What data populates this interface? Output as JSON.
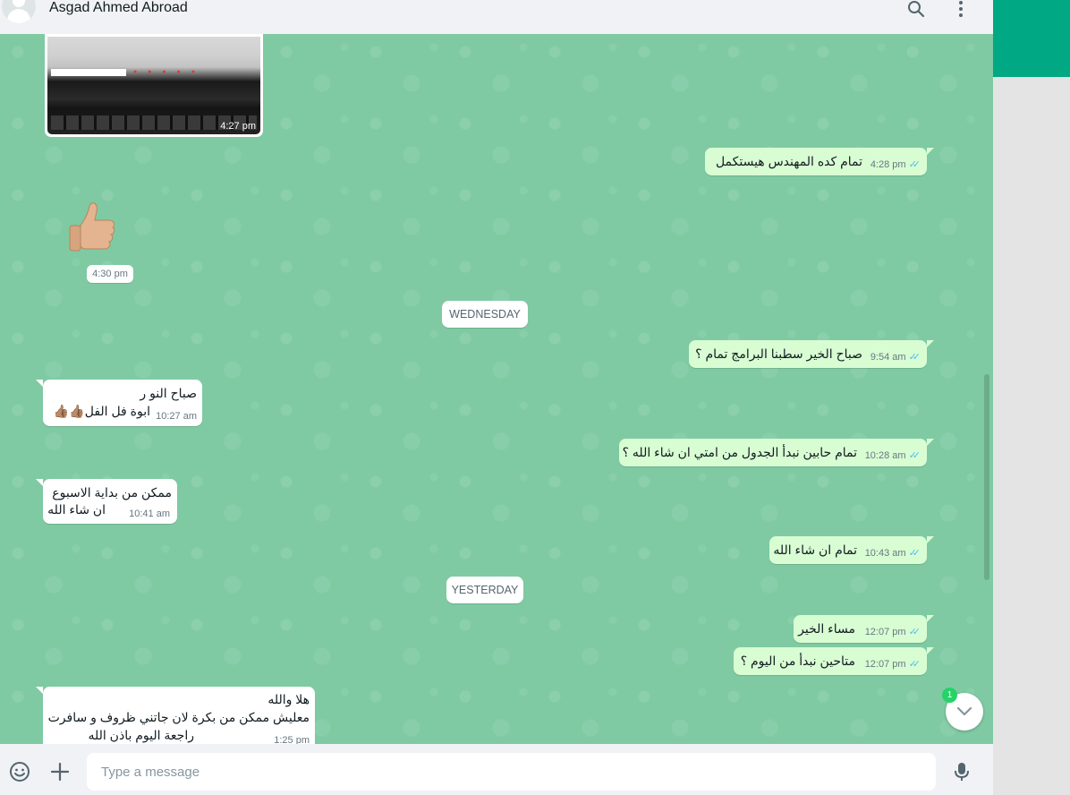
{
  "header": {
    "contact_name": "Asgad Ahmed Abroad"
  },
  "messages": {
    "img_time": "4:27 pm",
    "m1": {
      "text": "تمام كده المهندس هيستكمل",
      "time": "4:28 pm"
    },
    "thumb_time": "4:30 pm",
    "chip_wed": "WEDNESDAY",
    "m2": {
      "text": "صباح الخير سطبنا البرامج تمام ؟",
      "time": "9:54 am"
    },
    "m3": {
      "line1": "صباح النو ر",
      "line2": "ابوة فل الفل👍🏽👍🏽",
      "time": "10:27 am"
    },
    "m4": {
      "text": "تمام حابين نبدأ الجدول من امتي ان شاء الله ؟",
      "time": "10:28 am"
    },
    "m5": {
      "line1": "ممكن من بداية الاسبوع",
      "line2": "ان شاء الله",
      "time": "10:41 am"
    },
    "m6": {
      "text": "تمام ان شاء الله",
      "time": "10:43 am"
    },
    "chip_yesterday": "YESTERDAY",
    "m7": {
      "text": "مساء الخير",
      "time": "12:07 pm"
    },
    "m8": {
      "text": "متاحين نبدأ من اليوم ؟",
      "time": "12:07 pm"
    },
    "m9": {
      "line1": "هلا والله",
      "line2": "معليش ممكن من بكرة لان جاتني ظروف و سافرت",
      "line3": "راجعة اليوم باذن الله",
      "time": "1:25 pm"
    }
  },
  "scroll": {
    "unread_count": "1"
  },
  "footer": {
    "placeholder": "Type a message"
  },
  "colors": {
    "chat_bg": "#7fcaa3",
    "outgoing": "#d9fdd3",
    "incoming": "#ffffff",
    "accent": "#00a884",
    "ticks": "#53bdeb"
  },
  "icons": [
    "search-icon",
    "menu-icon",
    "emoji-icon",
    "attach-icon",
    "mic-icon",
    "chevron-down-icon",
    "avatar"
  ]
}
